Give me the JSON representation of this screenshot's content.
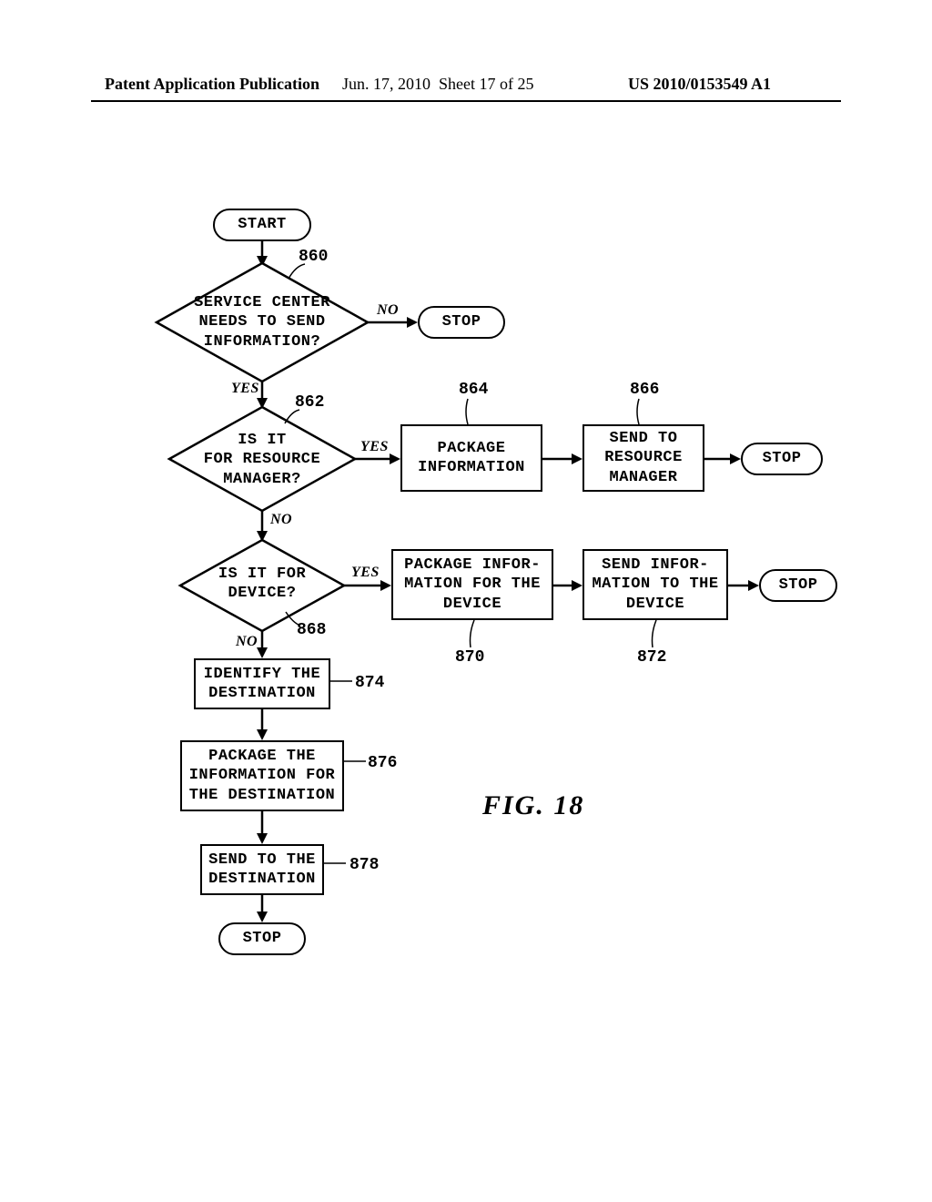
{
  "header": {
    "left": "Patent Application Publication",
    "date": "Jun. 17, 2010",
    "sheet": "Sheet 17 of 25",
    "pubno": "US 2010/0153549 A1"
  },
  "figure_title": "FIG. 18",
  "labels": {
    "yes": "YES",
    "no": "NO"
  },
  "shapes": {
    "start": "START",
    "stop": "STOP",
    "d860": "SERVICE CENTER\nNEEDS TO SEND\nINFORMATION?",
    "d862": "IS IT\nFOR RESOURCE\nMANAGER?",
    "b864": "PACKAGE\nINFORMATION",
    "b866": "SEND TO\nRESOURCE\nMANAGER",
    "d868": "IS IT FOR\nDEVICE?",
    "b870": "PACKAGE INFOR-\nMATION FOR THE\nDEVICE",
    "b872": "SEND INFOR-\nMATION TO THE\nDEVICE",
    "b874": "IDENTIFY THE\nDESTINATION",
    "b876": "PACKAGE THE\nINFORMATION FOR\nTHE DESTINATION",
    "b878": "SEND TO THE\nDESTINATION"
  },
  "refs": {
    "r860": "860",
    "r862": "862",
    "r864": "864",
    "r866": "866",
    "r868": "868",
    "r870": "870",
    "r872": "872",
    "r874": "874",
    "r876": "876",
    "r878": "878"
  }
}
